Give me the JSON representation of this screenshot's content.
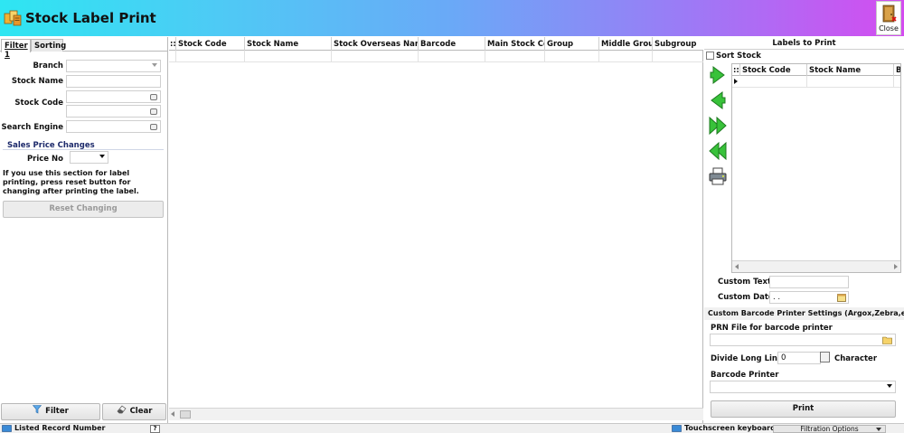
{
  "window": {
    "title": "Stock Label Print",
    "close_label": "Close"
  },
  "left_panel": {
    "tabs": [
      {
        "label": "Filter 1"
      },
      {
        "label": "Sorting"
      }
    ],
    "fields": {
      "branch_label": "Branch",
      "branch_value": "",
      "stock_name_label": "Stock Name",
      "stock_name_value": "",
      "stock_code_label": "Stock Code",
      "stock_code_value_1": "",
      "stock_code_value_2": "",
      "search_engine_label": "Search Engine",
      "search_engine_value": ""
    },
    "sales_price": {
      "title": "Sales Price Changes",
      "price_no_label": "Price No",
      "price_no_value": "",
      "note": "If you use this section for label printing, press reset button for changing after printing the label.",
      "reset_label": "Reset Changing"
    },
    "filter_label": "Filter",
    "clear_label": "Clear"
  },
  "grid": {
    "columns": [
      "Stock Code",
      "Stock Name",
      "Stock Overseas Name",
      "Barcode",
      "Main Stock Cod",
      "Group",
      "Middle Group",
      "Subgroup"
    ],
    "rows": []
  },
  "right_panel": {
    "title": "Labels to Print",
    "sort_stock_label": "Sort Stock",
    "sort_stock_checked": false,
    "arrow_buttons": [
      "add-arrow-icon",
      "remove-arrow-icon",
      "add-all-arrow-icon",
      "remove-all-arrow-icon",
      "printer-icon"
    ],
    "labels_grid": {
      "columns": [
        "Stock Code",
        "Stock Name",
        "B"
      ]
    },
    "custom_text_label": "Custom Text",
    "custom_text_value": "",
    "custom_date_label": "Custom Date",
    "custom_date_value": ". .",
    "settings_title": "Custom Barcode Printer Settings (Argox,Zebra,etc)",
    "prn_file_label": "PRN File for barcode printer",
    "prn_file_value": "",
    "divide_label": "Divide Long Lines",
    "divide_value": "0",
    "character_label": "Character",
    "barcode_printer_label": "Barcode Printer",
    "barcode_printer_value": "",
    "print_label": "Print"
  },
  "statusbar": {
    "listed_record_label": "Listed Record Number",
    "help_label": "?",
    "touchscreen_label": "Touchscreen keyboard",
    "filtration_label": "Filtration Options"
  },
  "colors": {
    "title_gradient_start": "#2ee6f2",
    "title_gradient_end": "#d44cf0",
    "arrow_green": "#2fb52f",
    "section_title": "#1d2a6b"
  }
}
